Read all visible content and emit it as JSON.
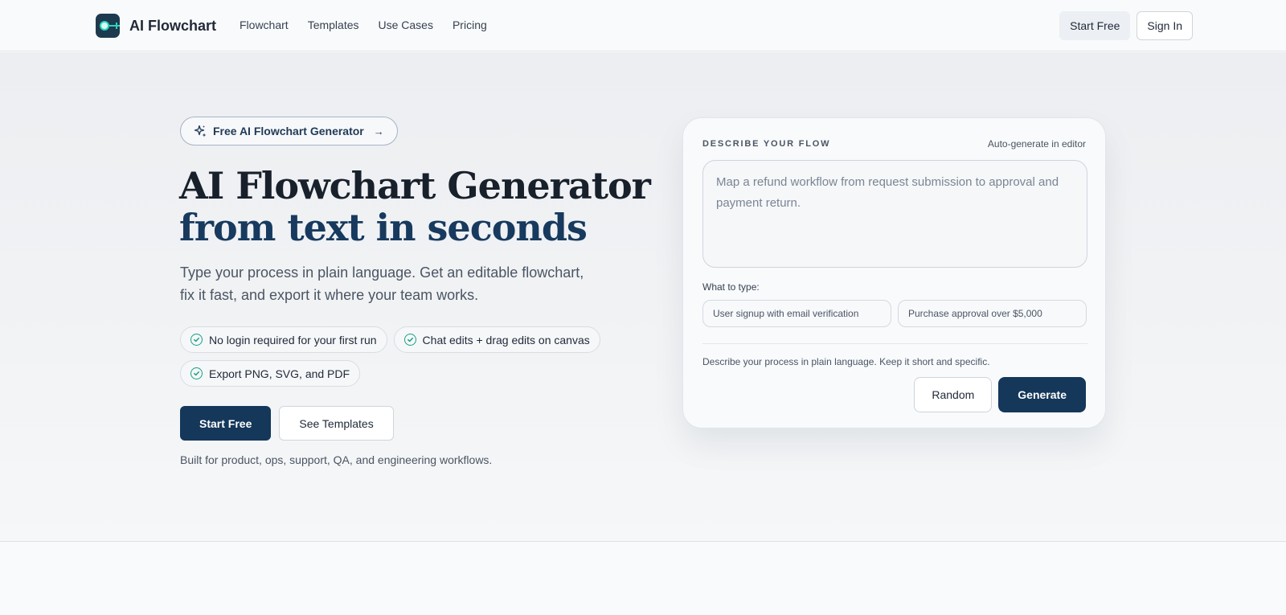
{
  "nav": {
    "brand": "AI Flowchart",
    "links": [
      "Flowchart",
      "Templates",
      "Use Cases",
      "Pricing"
    ],
    "start_free": "Start Free",
    "sign_in": "Sign In"
  },
  "hero": {
    "badge": "Free AI Flowchart Generator",
    "badge_arrow": "→",
    "headline_line1": "AI Flowchart Generator",
    "headline_line2": "from text in seconds",
    "subtext": "Type your process in plain language. Get an editable flowchart, fix it fast, and export it where your team works.",
    "features": [
      "No login required for your first run",
      "Chat edits + drag edits on canvas",
      "Export PNG, SVG, and PDF"
    ],
    "cta_primary": "Start Free",
    "cta_secondary": "See Templates",
    "built_for": "Built for product, ops, support, QA, and engineering workflows."
  },
  "card": {
    "title": "DESCRIBE YOUR FLOW",
    "hint": "Auto-generate in editor",
    "textarea_value": "",
    "textarea_placeholder": "Map a refund workflow from request submission to approval and payment return.",
    "examples_label": "What to type:",
    "examples": [
      "User signup with email verification",
      "Purchase approval over $5,000"
    ],
    "help": "Describe your process in plain language. Keep it short and specific.",
    "random": "Random",
    "generate": "Generate"
  },
  "icons": {
    "logo": "flow-node-icon",
    "badge": "sparkle-icon",
    "feature": "check-circle-icon"
  },
  "colors": {
    "primary": "#14375a",
    "headline_dark": "#18202b",
    "headline_accent": "#173a5e",
    "check": "#16a085"
  }
}
